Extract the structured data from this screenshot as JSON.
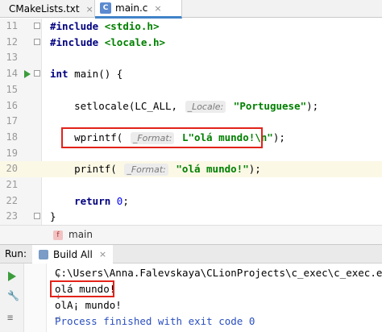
{
  "tabs": [
    {
      "label": "CMakeLists.txt",
      "icon": "cmake-file-icon",
      "active": false
    },
    {
      "label": "main.c",
      "icon": "c-file-icon",
      "active": true
    }
  ],
  "tab_close_glyph": "×",
  "editor": {
    "lines": [
      {
        "num": "11"
      },
      {
        "num": "12"
      },
      {
        "num": "13"
      },
      {
        "num": "14"
      },
      {
        "num": "15"
      },
      {
        "num": "16"
      },
      {
        "num": "17"
      },
      {
        "num": "18"
      },
      {
        "num": "19"
      },
      {
        "num": "20"
      },
      {
        "num": "21"
      },
      {
        "num": "22"
      },
      {
        "num": "23"
      }
    ],
    "code": {
      "l11_pp": "#include",
      "l11_inc": " <stdio.h>",
      "l12_pp": "#include",
      "l12_inc": " <locale.h>",
      "l14_kw": "int",
      "l14_rest": " main() {",
      "l16_a": "    setlocale(LC_ALL, ",
      "l16_hint": "_Locale:",
      "l16_str": "\"Portuguese\"",
      "l16_end": ");",
      "l18_a": "    wprintf( ",
      "l18_hint": "_Format:",
      "l18_str": "L\"olá mundo!\\n\"",
      "l18_end": ");",
      "l20_a": "    printf( ",
      "l20_hint": "_Format:",
      "l20_str": "\"olá mundo!\"",
      "l20_end": ");",
      "l22_kw": "    return",
      "l22_num": " 0",
      "l22_end": ";",
      "l23": "}"
    }
  },
  "breadcrumb": {
    "icon_letter": "f",
    "label": "main"
  },
  "run_panel": {
    "label": "Run:",
    "tab_label": "Build All",
    "close_glyph": "×",
    "output": [
      "C:\\Users\\Anna.Falevskaya\\CLionProjects\\c_exec\\c_exec.exe",
      "olá mundo!",
      "olA¡ mundo!",
      "Process finished with exit code 0"
    ]
  },
  "colors": {
    "highlight_box": "#e2231a",
    "active_tab_underline": "#4083c9",
    "run_green": "#3c9c3c"
  }
}
